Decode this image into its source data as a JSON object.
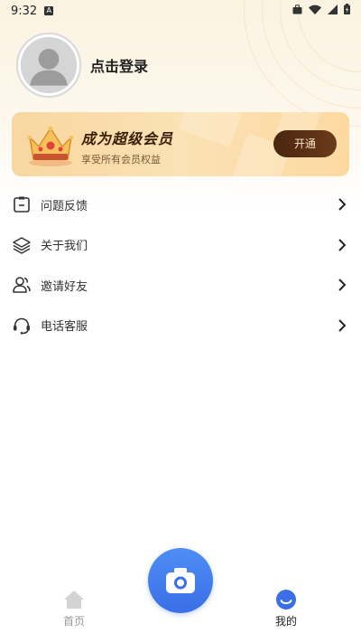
{
  "status_bar": {
    "time": "9:32",
    "indicator": "A",
    "icons": [
      "briefcase-icon",
      "wifi-icon",
      "signal-icon",
      "battery-icon"
    ]
  },
  "profile": {
    "login_label": "点击登录",
    "avatar_icon": "user-avatar-icon"
  },
  "vip": {
    "title": "成为超级会员",
    "subtitle": "享受所有会员权益",
    "button_label": "开通",
    "icon": "crown-icon"
  },
  "menu": {
    "items": [
      {
        "label": "问题反馈",
        "icon": "clipboard-icon"
      },
      {
        "label": "关于我们",
        "icon": "layers-icon"
      },
      {
        "label": "邀请好友",
        "icon": "users-icon"
      },
      {
        "label": "电话客服",
        "icon": "headset-icon"
      }
    ]
  },
  "bottom_nav": {
    "home_label": "首页",
    "mine_label": "我的",
    "camera_icon": "camera-icon",
    "active": "我的"
  },
  "colors": {
    "accent_blue": "#3a6fe8",
    "vip_gold": "#f8d7a0",
    "vip_button": "#4a2610",
    "hero_bg": "#fbf3e1"
  }
}
